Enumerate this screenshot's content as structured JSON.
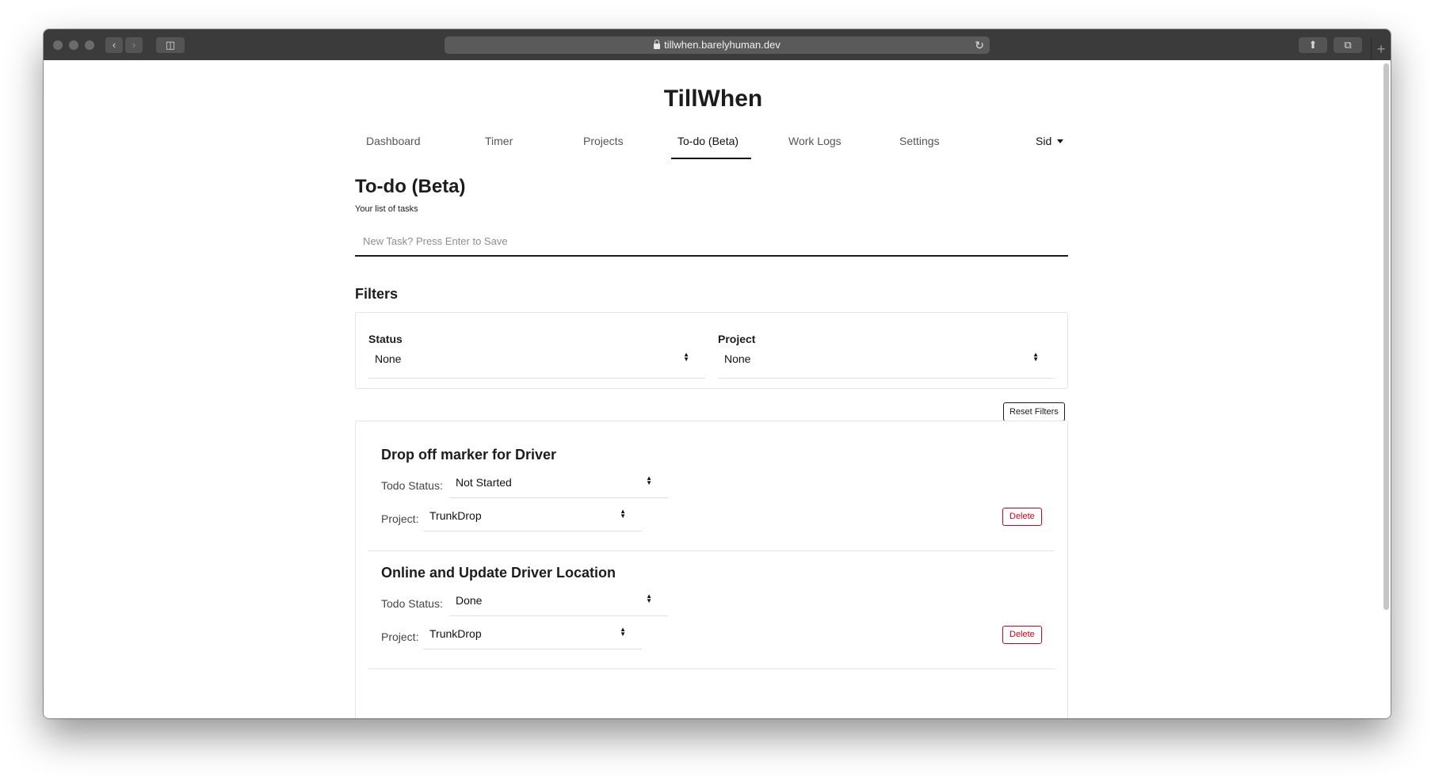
{
  "browser": {
    "url": "tillwhen.barelyhuman.dev",
    "back_icon": "chevron-left-icon",
    "forward_icon": "chevron-right-icon",
    "sidebar_icon": "sidebar-icon",
    "share_icon": "share-icon",
    "tabs_icon": "tabs-icon",
    "reload_icon": "reload-icon",
    "new_tab_icon": "plus-icon"
  },
  "app": {
    "title": "TillWhen"
  },
  "nav": {
    "items": [
      {
        "label": "Dashboard"
      },
      {
        "label": "Timer"
      },
      {
        "label": "Projects"
      },
      {
        "label": "To-do (Beta)",
        "active": true
      },
      {
        "label": "Work Logs"
      },
      {
        "label": "Settings"
      }
    ],
    "user": "Sid"
  },
  "page": {
    "title": "To-do (Beta)",
    "subtitle": "Your list of tasks",
    "new_task_placeholder": "New Task? Press Enter to Save"
  },
  "filters": {
    "heading": "Filters",
    "status_label": "Status",
    "status_value": "None",
    "project_label": "Project",
    "project_value": "None",
    "reset_label": "Reset Filters"
  },
  "tasks": [
    {
      "title": "Drop off marker for Driver",
      "status_label": "Todo Status:",
      "status": "Not Started",
      "project_label": "Project:",
      "project": "TrunkDrop",
      "delete_label": "Delete"
    },
    {
      "title": "Online and Update Driver Location",
      "status_label": "Todo Status:",
      "status": "Done",
      "project_label": "Project:",
      "project": "TrunkDrop",
      "delete_label": "Delete"
    }
  ],
  "colors": {
    "accent": "#1c1c1c",
    "danger": "#d0021b",
    "toolbar": "#3b3b3b"
  }
}
